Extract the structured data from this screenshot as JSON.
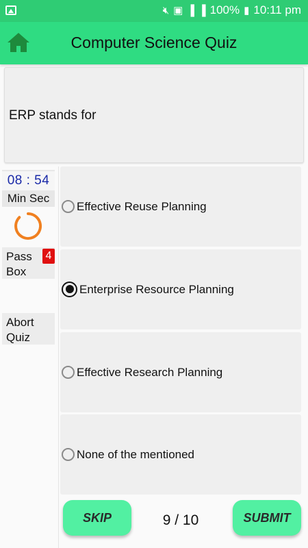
{
  "status_bar": {
    "battery": "100%",
    "time": "10:11 pm"
  },
  "app_bar": {
    "title": "Computer Science Quiz"
  },
  "question": {
    "text": "ERP stands for"
  },
  "timer": {
    "value": "08 : 54",
    "units": "Min  Sec"
  },
  "pass_box": {
    "label": "Pass Box",
    "count": "4"
  },
  "abort": {
    "label": "Abort Quiz"
  },
  "options": [
    {
      "label": "Effective Reuse Planning",
      "selected": false
    },
    {
      "label": "Enterprise Resource Planning",
      "selected": true
    },
    {
      "label": "Effective Research Planning",
      "selected": false
    },
    {
      "label": "None of the mentioned",
      "selected": false
    }
  ],
  "bottom": {
    "skip_label": "SKIP",
    "progress": "9 / 10",
    "submit_label": "SUBMIT"
  },
  "colors": {
    "app_bar": "#2fdc82",
    "button": "#52f0a2",
    "timer_text": "#1a2aa8",
    "badge": "#e01010",
    "spinner": "#f08020"
  }
}
